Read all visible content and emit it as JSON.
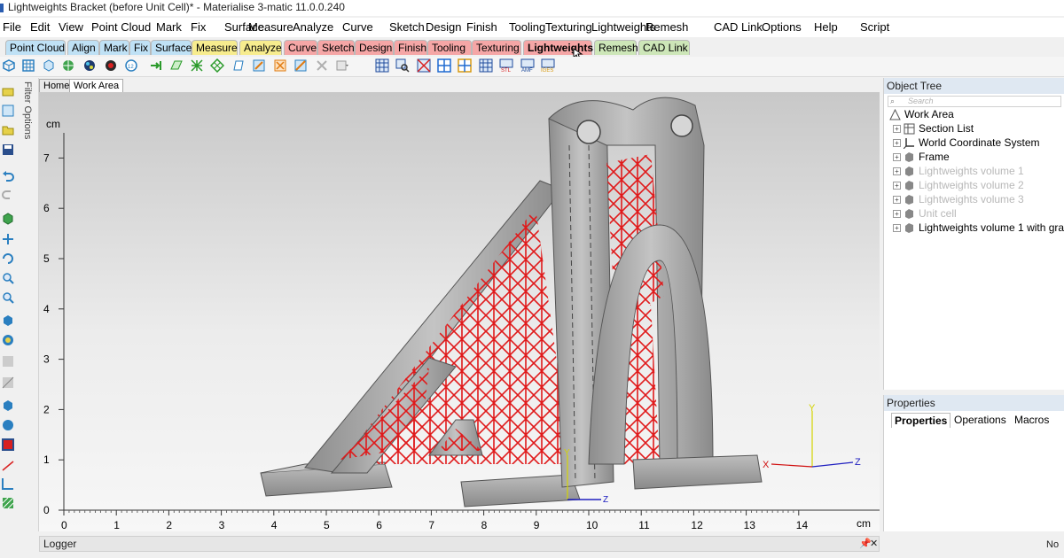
{
  "window": {
    "title": "Lightweights Bracket (before Unit Cell)* - Materialise 3-matic 11.0.0.240"
  },
  "menu": [
    "File",
    "Edit",
    "View",
    "Point Cloud",
    "Mark",
    "Fix",
    "Surface",
    "Measure",
    "Analyze",
    "Curve",
    "Sketch",
    "Design",
    "Finish",
    "Tooling",
    "Texturing",
    "Lightweights",
    "Remesh",
    "CAD Link",
    "Options",
    "Help",
    "Script"
  ],
  "ribbon_tabs": [
    {
      "label": "Point Cloud",
      "color": "#bfe1f5"
    },
    {
      "label": "Align",
      "color": "#bfe1f5"
    },
    {
      "label": "Mark",
      "color": "#bfe1f5"
    },
    {
      "label": "Fix",
      "color": "#bfe1f5"
    },
    {
      "label": "Surface",
      "color": "#bfe1f5"
    },
    {
      "label": "Measure",
      "color": "#f7ec8e"
    },
    {
      "label": "Analyze",
      "color": "#f7ec8e"
    },
    {
      "label": "Curve",
      "color": "#f5a6a6"
    },
    {
      "label": "Sketch",
      "color": "#f5a6a6"
    },
    {
      "label": "Design",
      "color": "#f5a6a6"
    },
    {
      "label": "Finish",
      "color": "#f5a6a6"
    },
    {
      "label": "Tooling",
      "color": "#f5a6a6"
    },
    {
      "label": "Texturing",
      "color": "#f5a6a6"
    },
    {
      "label": "Lightweights",
      "color": "#f5a6a6",
      "active": true
    },
    {
      "label": "Remesh",
      "color": "#cde6b8"
    },
    {
      "label": "CAD Link",
      "color": "#cde6b8"
    }
  ],
  "left_panel": {
    "filter_label": "Filter Options"
  },
  "view_tabs": [
    "Home",
    "Work Area"
  ],
  "viewport": {
    "unit_label": "cm",
    "y_ticks": [
      "0",
      "1",
      "2",
      "3",
      "4",
      "5",
      "6",
      "7"
    ],
    "x_ticks": [
      "0",
      "1",
      "2",
      "3",
      "4",
      "5",
      "6",
      "7",
      "8",
      "9",
      "10",
      "11",
      "12",
      "13",
      "14"
    ],
    "axis_triad": {
      "x": "X",
      "y": "Y",
      "z": "Z"
    },
    "colors": {
      "part": "#a9a9a9",
      "lattice": "#e0191a",
      "x_axis": "#d01010",
      "y_axis": "#d4d400",
      "z_axis": "#2020c0"
    }
  },
  "logger": {
    "label": "Logger",
    "pin": "📌",
    "close": "✕"
  },
  "object_tree": {
    "title": "Object Tree",
    "search_placeholder": "Search",
    "items": [
      {
        "label": "Work Area",
        "icon": "work-area-icon",
        "dim": false
      },
      {
        "label": "Section List",
        "icon": "section-list-icon",
        "dim": false
      },
      {
        "label": "World Coordinate System",
        "icon": "coordinate-system-icon",
        "dim": false
      },
      {
        "label": "Frame",
        "icon": "part-icon",
        "dim": false
      },
      {
        "label": "Lightweights volume 1",
        "icon": "part-icon",
        "dim": true
      },
      {
        "label": "Lightweights volume 2",
        "icon": "part-icon",
        "dim": true
      },
      {
        "label": "Lightweights volume 3",
        "icon": "part-icon",
        "dim": true
      },
      {
        "label": "Unit cell",
        "icon": "part-icon",
        "dim": true
      },
      {
        "label": "Lightweights volume 1 with gra",
        "icon": "part-icon",
        "dim": false
      }
    ]
  },
  "properties": {
    "title": "Properties",
    "tabs": [
      "Properties",
      "Operations",
      "Macros"
    ]
  },
  "status": {
    "right_text": "No"
  }
}
